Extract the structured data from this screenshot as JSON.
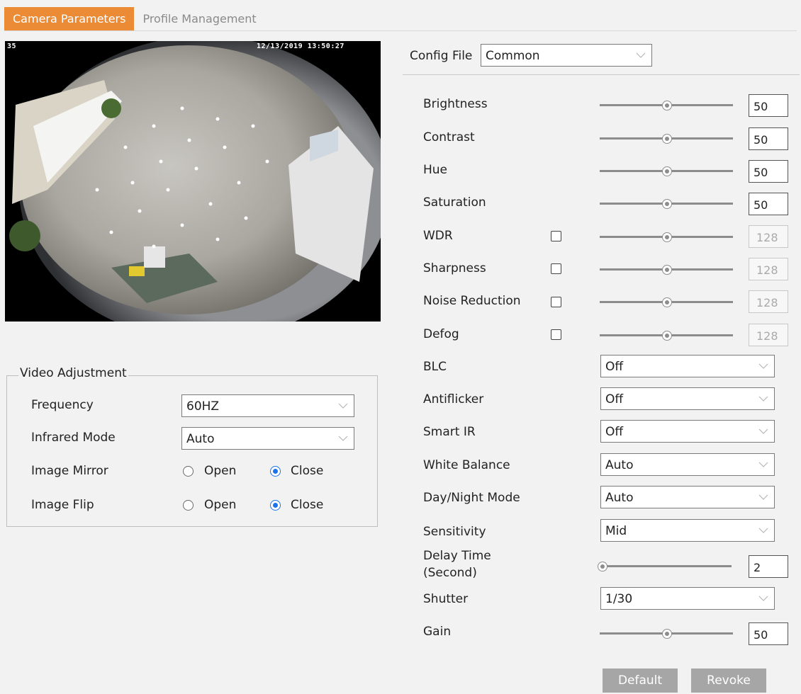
{
  "tabs": [
    {
      "label": "Camera Parameters",
      "active": true
    },
    {
      "label": "Profile Management",
      "active": false
    }
  ],
  "video": {
    "osd_left": "35",
    "osd_timestamp": "12/13/2019 13:50:27"
  },
  "video_adjustment": {
    "legend": "Video Adjustment",
    "frequency": {
      "label": "Frequency",
      "value": "60HZ"
    },
    "infrared_mode": {
      "label": "Infrared Mode",
      "value": "Auto"
    },
    "image_mirror": {
      "label": "Image Mirror",
      "open": "Open",
      "close": "Close",
      "selected": "Close"
    },
    "image_flip": {
      "label": "Image Flip",
      "open": "Open",
      "close": "Close",
      "selected": "Close"
    }
  },
  "config_file": {
    "label": "Config File",
    "value": "Common"
  },
  "params": {
    "brightness": {
      "label": "Brightness",
      "value": "50"
    },
    "contrast": {
      "label": "Contrast",
      "value": "50"
    },
    "hue": {
      "label": "Hue",
      "value": "50"
    },
    "saturation": {
      "label": "Saturation",
      "value": "50"
    },
    "wdr": {
      "label": "WDR",
      "value": "128",
      "enabled": false
    },
    "sharpness": {
      "label": "Sharpness",
      "value": "128",
      "enabled": false
    },
    "noise_reduction": {
      "label": "Noise Reduction",
      "value": "128",
      "enabled": false
    },
    "defog": {
      "label": "Defog",
      "value": "128",
      "enabled": false
    },
    "blc": {
      "label": "BLC",
      "value": "Off"
    },
    "antiflicker": {
      "label": "Antiflicker",
      "value": "Off"
    },
    "smart_ir": {
      "label": "Smart IR",
      "value": "Off"
    },
    "white_balance": {
      "label": "White Balance",
      "value": "Auto"
    },
    "day_night_mode": {
      "label": "Day/Night Mode",
      "value": "Auto"
    },
    "sensitivity": {
      "label": "Sensitivity",
      "value": "Mid"
    },
    "delay_time": {
      "label_line1": "Delay Time",
      "label_line2": "(Second)",
      "value": "2"
    },
    "shutter": {
      "label": "Shutter",
      "value": "1/30"
    },
    "gain": {
      "label": "Gain",
      "value": "50"
    }
  },
  "buttons": {
    "default": "Default",
    "revoke": "Revoke"
  },
  "colors": {
    "accent_tab": "#ec8b35",
    "radio_selected": "#1a73e8",
    "button_gray": "#a6a6a6"
  }
}
